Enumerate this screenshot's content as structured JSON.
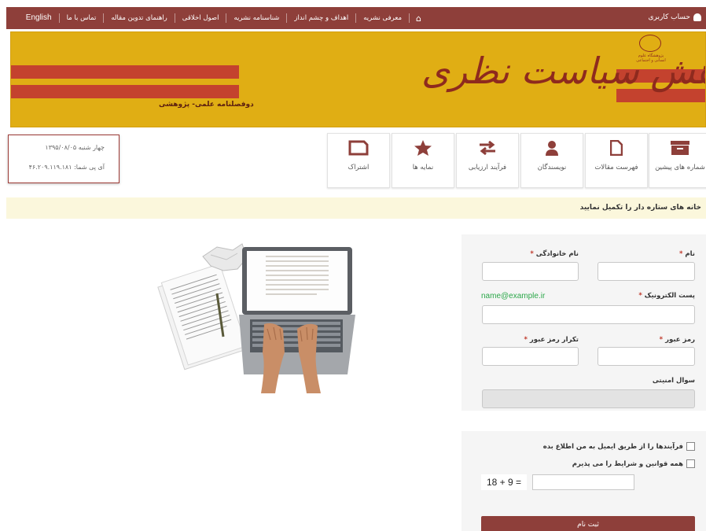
{
  "topbar": {
    "account_label": "حساب کاربری",
    "nav": [
      "معرفی نشریه",
      "اهداف و چشم انداز",
      "شناسنامه نشریه",
      "اصول اخلاقی",
      "راهنمای تدوین مقاله",
      "تماس با ما",
      "English"
    ]
  },
  "banner": {
    "title": "پژوهش سیاست نظری",
    "subtitle": "دوفصلنامه علمی- پژوهشی",
    "logo_text": "پژوهشگاه علوم انسانی و اجتماعی"
  },
  "datebox": {
    "date": "چهار شنبه ۱۳۹۵/۰۸/۰۵",
    "ip": "آی پی شما: ۴۶.۲۰۹.۱۱۹.۱۸۱"
  },
  "tiles": [
    {
      "label": "شماره های پیشین",
      "icon": "archive-icon"
    },
    {
      "label": "فهرست مقالات",
      "icon": "document-icon"
    },
    {
      "label": "نویسندگان",
      "icon": "user-icon"
    },
    {
      "label": "فرآیند ارزیابی",
      "icon": "exchange-icon"
    },
    {
      "label": "نمایه ها",
      "icon": "star-icon"
    },
    {
      "label": "اشتراک",
      "icon": "folder-icon"
    }
  ],
  "notice": "خانه های ستاره دار را تکمیل نمایید",
  "form": {
    "first_name_label": "نام",
    "last_name_label": "نام خانوادگی",
    "email_label": "پست الکترونیک",
    "email_placeholder": "name@example.ir",
    "password_label": "رمز عبور",
    "password_repeat_label": "تکرار رمز عبور",
    "security_question_label": "سوال امنیتی",
    "required_mark": "*",
    "notify_label": "فرآیندها را از طریق ایمیل به من اطلاع بده",
    "terms_label": "همه قوانین و شرایط را می پذیرم",
    "captcha_question": "18 + 9 =",
    "submit_label": "ثبت نام"
  },
  "colors": {
    "brand": "#8e3f3a",
    "banner_bg": "#e0ae14",
    "banner_stripe": "#c4422e",
    "notice_bg": "#fbf7dc",
    "email_hint": "#2ca84a"
  }
}
